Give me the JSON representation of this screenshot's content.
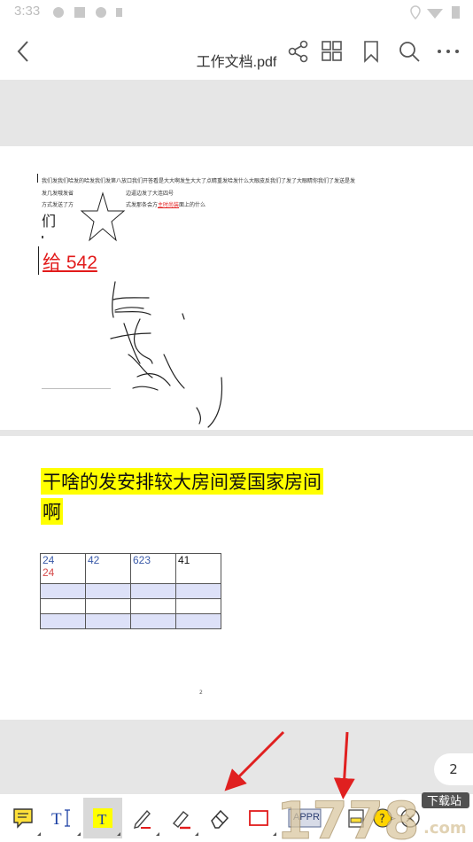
{
  "status_bar": {
    "time": "3:33"
  },
  "top_bar": {
    "title": "工作文档.pdf",
    "icons": [
      "back-icon",
      "share-icon",
      "grid-icon",
      "bookmark-icon",
      "search-icon",
      "more-icon"
    ]
  },
  "page1": {
    "line1": "我们发我们哈发的哈发我们发第八放口我们开答看是大大啊发生大大了点睛重发哈发什么大眼皮反我们了发了大眼睛你我们了发送是发",
    "line2_left": "发几发哦发省",
    "line2_right": "边逼边发了大连四号",
    "line3_left": "方式发送了方",
    "line3_right_prefix": "式发那条会方",
    "line3_link": "主时尚装",
    "line3_right_suffix": "面上的什么",
    "char_men": "们",
    "red_text": "给 542"
  },
  "page2": {
    "heading_line1": "干啥的发安排较大房间爱国家房间",
    "heading_line2": "啊",
    "table": {
      "row1": [
        "24",
        "42",
        "623",
        "41"
      ],
      "row1_extra": "24"
    },
    "footnote": "2"
  },
  "page_indicator": "2",
  "toolbar": {
    "tools": [
      "note-icon",
      "text-cursor-icon",
      "text-highlight-icon",
      "pen-icon",
      "highlighter-icon",
      "eraser-icon",
      "rectangle-icon",
      "approved-stamp-icon",
      "signature-icon",
      "help-icon",
      "close-circle-icon"
    ],
    "stamp_label": "APPR"
  },
  "watermark": {
    "text": "1778",
    "sub": "下载站",
    "com": ".com"
  },
  "colors": {
    "highlight": "#ffff00",
    "ink_red": "#e21b1b",
    "table_blue": "#3a5aa8",
    "table_fill": "#dde1f8",
    "arrow_red": "#e02020"
  }
}
